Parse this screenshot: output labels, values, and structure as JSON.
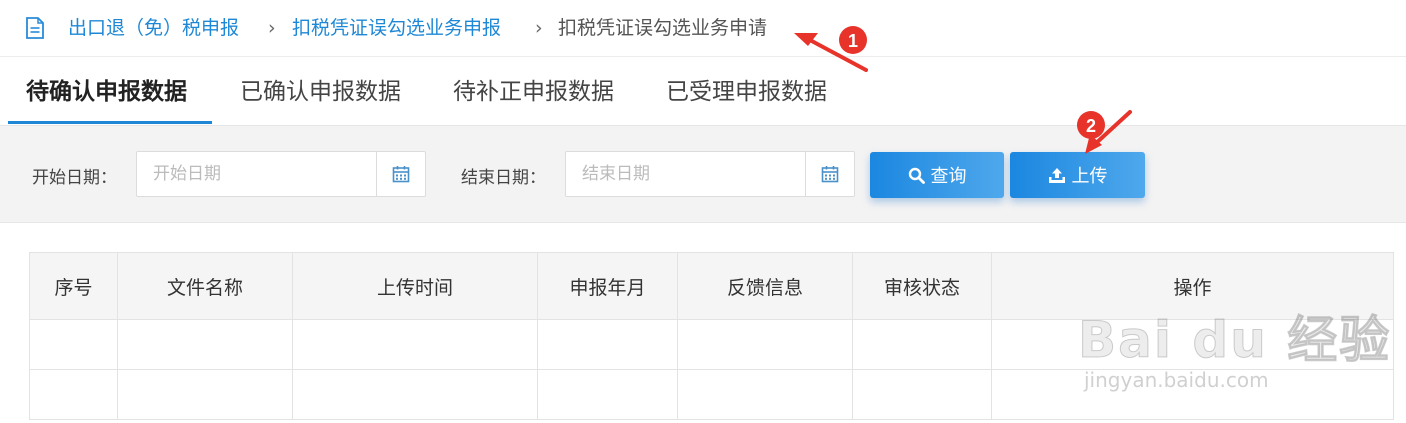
{
  "breadcrumb": {
    "icon": "document-icon",
    "items": [
      {
        "label": "出口退（免）税申报"
      },
      {
        "label": "扣税凭证误勾选业务申报"
      },
      {
        "label": "扣税凭证误勾选业务申请"
      }
    ],
    "separator": "›"
  },
  "tabs": [
    {
      "label": "待确认申报数据",
      "active": true
    },
    {
      "label": "已确认申报数据",
      "active": false
    },
    {
      "label": "待补正申报数据",
      "active": false
    },
    {
      "label": "已受理申报数据",
      "active": false
    }
  ],
  "filter": {
    "start_label": "开始日期：",
    "start_placeholder": "开始日期",
    "start_value": "",
    "end_label": "结束日期：",
    "end_placeholder": "结束日期",
    "end_value": "",
    "calendar_icon": "calendar-icon",
    "query_label": "查询",
    "query_icon": "search-icon",
    "upload_label": "上传",
    "upload_icon": "upload-icon"
  },
  "table": {
    "headers": [
      "序号",
      "文件名称",
      "上传时间",
      "申报年月",
      "反馈信息",
      "审核状态",
      "操作"
    ],
    "rows": [
      [
        "",
        "",
        "",
        "",
        "",
        "",
        ""
      ],
      [
        "",
        "",
        "",
        "",
        "",
        "",
        ""
      ]
    ]
  },
  "annotations": [
    {
      "number": "1"
    },
    {
      "number": "2"
    }
  ],
  "watermark": {
    "brand": "Bai du 经验",
    "url": "jingyan.baidu.com"
  },
  "colors": {
    "accent": "#1e88d6",
    "button": "#2e8fe3",
    "annotation_red": "#e8332a"
  }
}
